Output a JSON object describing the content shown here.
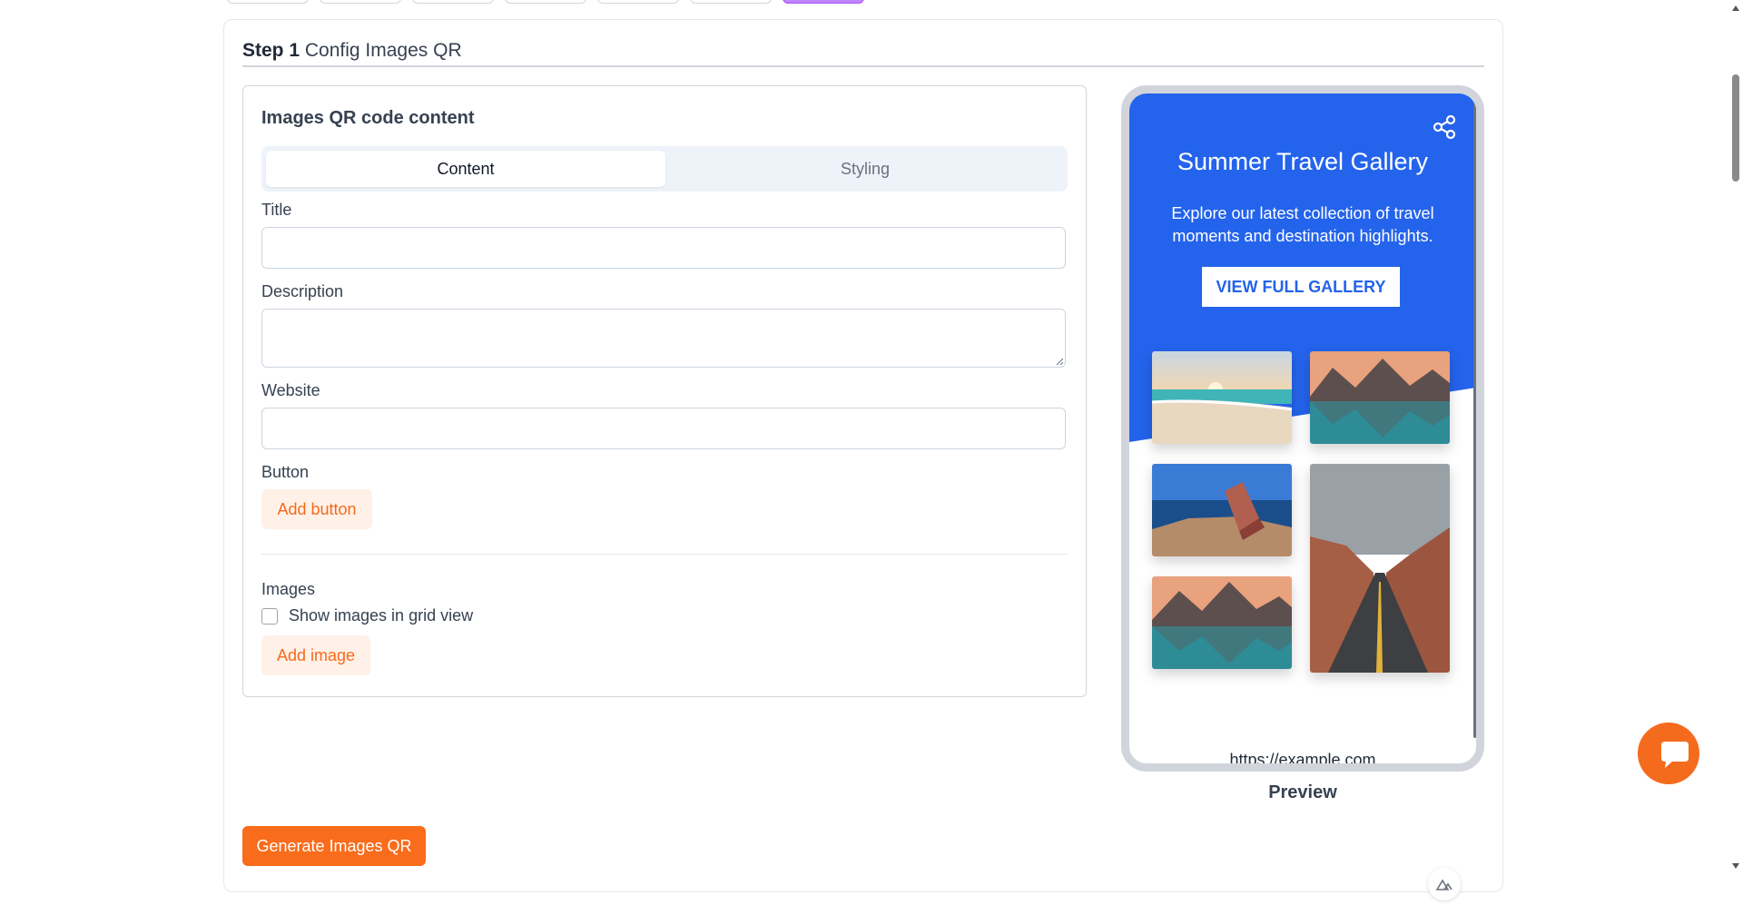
{
  "step": {
    "number": "Step 1",
    "title": "Config Images QR"
  },
  "content_card": {
    "title": "Images QR code content",
    "tabs": {
      "content": "Content",
      "styling": "Styling"
    },
    "fields": {
      "title_label": "Title",
      "title_value": "",
      "description_label": "Description",
      "description_value": "",
      "website_label": "Website",
      "website_value": ""
    },
    "button_section": {
      "label": "Button",
      "add_label": "Add button"
    },
    "images_section": {
      "label": "Images",
      "grid_checkbox_label": "Show images in grid view",
      "add_label": "Add image"
    }
  },
  "generate_label": "Generate Images QR",
  "preview": {
    "title": "Summer Travel Gallery",
    "description": "Explore our latest collection of travel moments and destination highlights.",
    "button_label": "VIEW FULL GALLERY",
    "url": "https://example.com",
    "label": "Preview"
  },
  "colors": {
    "accent_orange": "#f86c1b",
    "preview_blue": "#2463eb",
    "button_tint": "#fff1e8"
  },
  "icons": [
    "share-icon",
    "chat-icon",
    "loader-icon",
    "scroll-up-arrow-icon",
    "scroll-down-arrow-icon"
  ]
}
